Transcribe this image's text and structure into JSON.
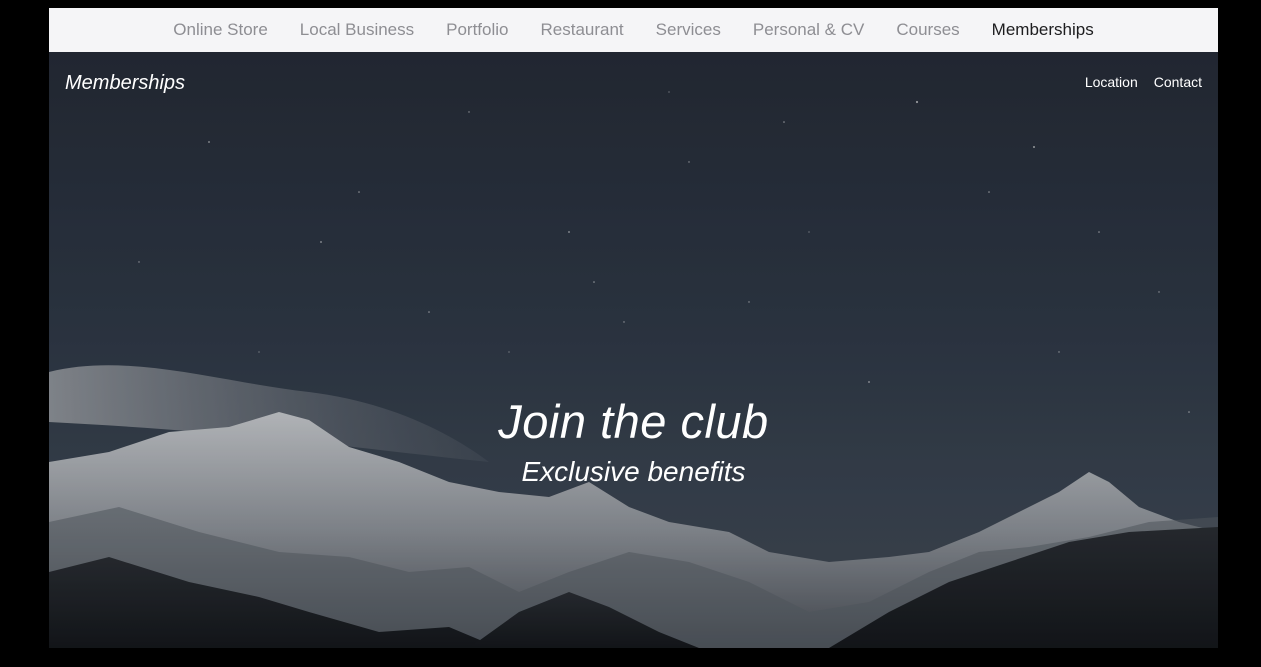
{
  "top_nav": {
    "tabs": [
      {
        "label": "Online Store"
      },
      {
        "label": "Local Business"
      },
      {
        "label": "Portfolio"
      },
      {
        "label": "Restaurant"
      },
      {
        "label": "Services"
      },
      {
        "label": "Personal & CV"
      },
      {
        "label": "Courses"
      },
      {
        "label": "Memberships"
      }
    ],
    "active_tab": "Memberships"
  },
  "site": {
    "brand": "Memberships",
    "nav": {
      "location": "Location",
      "contact": "Contact"
    }
  },
  "hero": {
    "headline": "Join the club",
    "subheadline": "Exclusive benefits"
  },
  "colors": {
    "nav_bg": "#f5f5f7",
    "nav_text": "#8e8e93",
    "nav_active": "#1d1d1f",
    "sky_top": "#2a3140",
    "sky_bottom": "#3a4452",
    "text": "#ffffff"
  }
}
